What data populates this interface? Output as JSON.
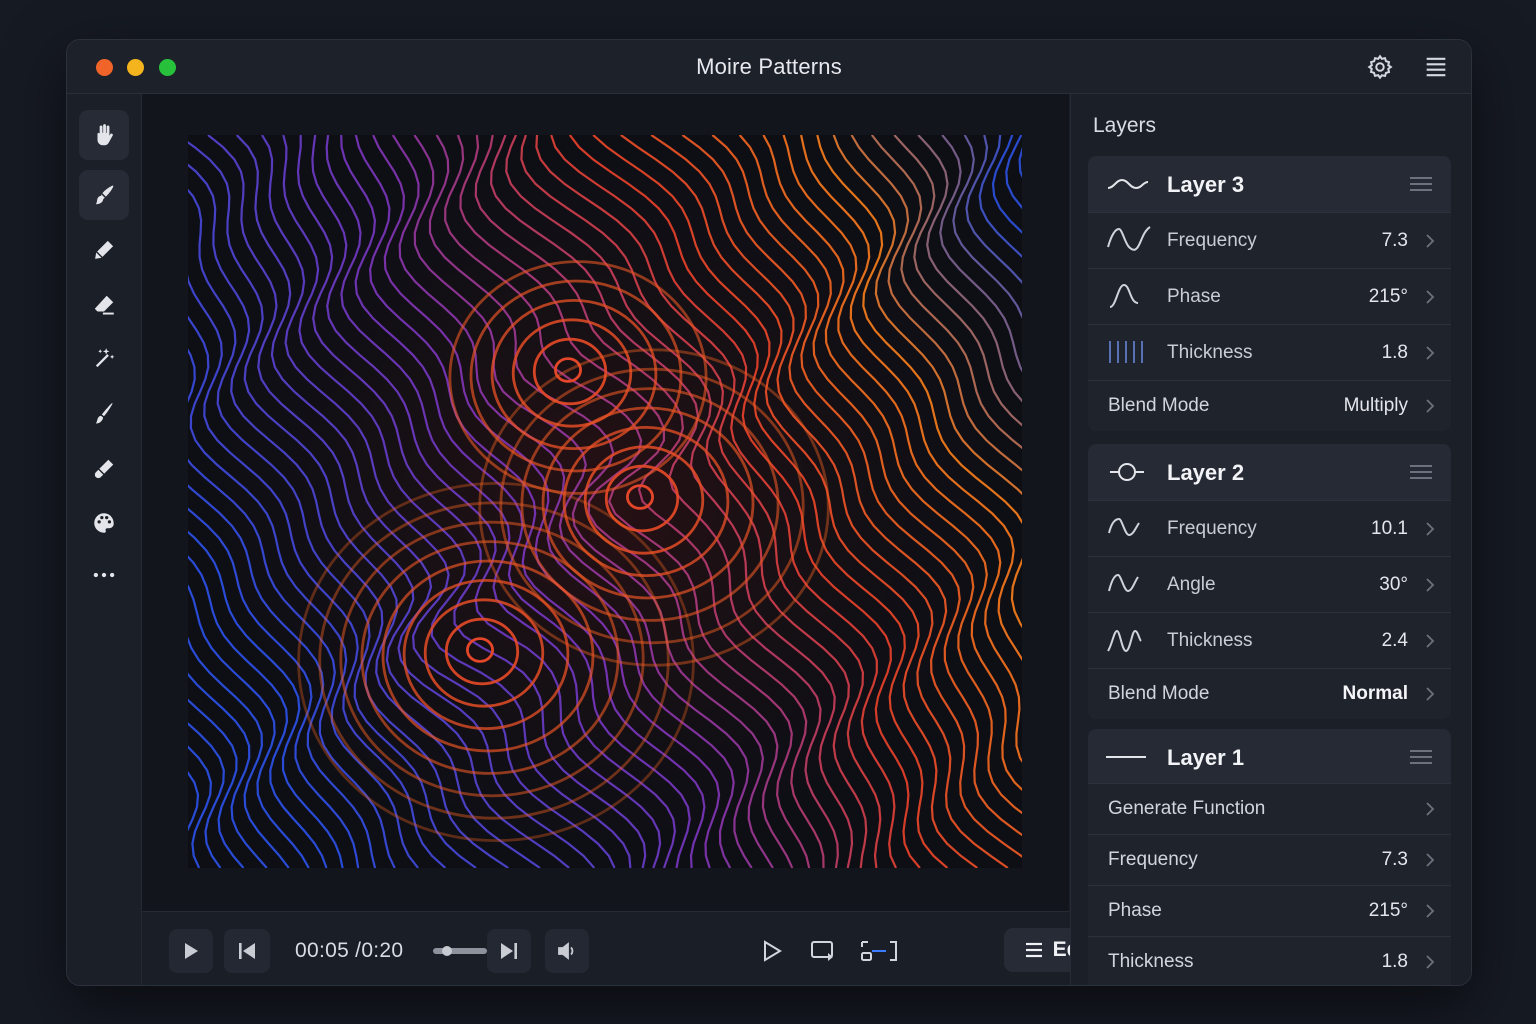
{
  "window": {
    "title": "Moire Patterns"
  },
  "titlebar_icons": [
    "gear-icon",
    "menu-icon"
  ],
  "tools": [
    "hand-icon",
    "brush-icon",
    "pencil-icon",
    "eraser-icon",
    "magic-wand-icon",
    "paintbrush-icon",
    "marker-icon",
    "palette-icon",
    "more-icon"
  ],
  "playback": {
    "time": "00:05 /0:20",
    "progress": 0.25,
    "edit_label": "Edit"
  },
  "panel": {
    "title": "Layers",
    "layers": [
      {
        "name": "Layer 3",
        "icon": "wave-icon",
        "rows": [
          {
            "label": "Frequency",
            "value": "7.3",
            "icon": "sine-wave-icon"
          },
          {
            "label": "Phase",
            "value": "215°",
            "icon": "phase-curve-icon"
          },
          {
            "label": "Thickness",
            "value": "1.8",
            "icon": "lines-icon"
          },
          {
            "label": "Blend Mode",
            "value": "Multiply"
          }
        ]
      },
      {
        "name": "Layer 2",
        "icon": "circle-line-icon",
        "rows": [
          {
            "label": "Frequency",
            "value": "10.1",
            "icon": "sine-wave-icon"
          },
          {
            "label": "Angle",
            "value": "30°",
            "icon": "sine-wave-icon"
          },
          {
            "label": "Thickness",
            "value": "2.4",
            "icon": "steep-wave-icon"
          },
          {
            "label": "Blend Mode",
            "value": "Normal"
          }
        ]
      },
      {
        "name": "Layer 1",
        "icon": "line-icon",
        "rows": [
          {
            "label": "Generate Function",
            "value": ""
          },
          {
            "label": "Frequency",
            "value": "7.3"
          },
          {
            "label": "Phase",
            "value": "215°"
          },
          {
            "label": "Thickness",
            "value": "1.8"
          }
        ]
      }
    ]
  },
  "colors": {
    "accent_orange": "#f07a1a",
    "accent_purple": "#8a3bb8",
    "accent_blue": "#2c4fd8",
    "background": "#161a23"
  }
}
